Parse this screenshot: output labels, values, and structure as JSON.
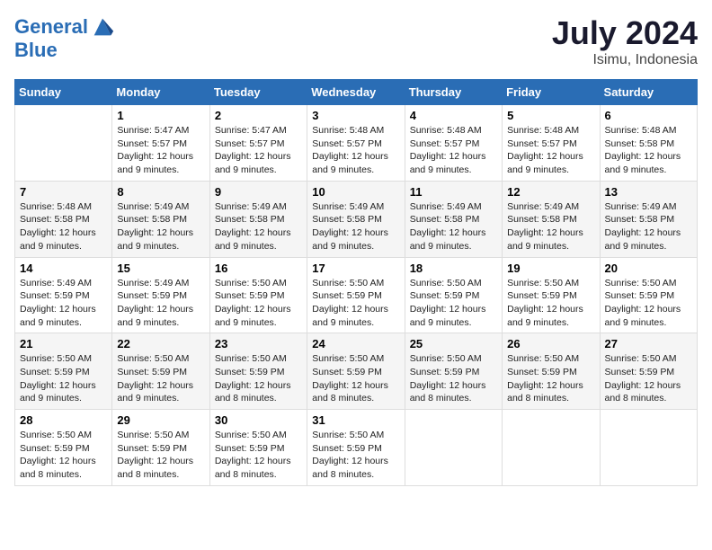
{
  "header": {
    "logo_line1": "General",
    "logo_line2": "Blue",
    "month_year": "July 2024",
    "location": "Isimu, Indonesia"
  },
  "days_of_week": [
    "Sunday",
    "Monday",
    "Tuesday",
    "Wednesday",
    "Thursday",
    "Friday",
    "Saturday"
  ],
  "weeks": [
    [
      {
        "day": "",
        "info": ""
      },
      {
        "day": "1",
        "info": "Sunrise: 5:47 AM\nSunset: 5:57 PM\nDaylight: 12 hours\nand 9 minutes."
      },
      {
        "day": "2",
        "info": "Sunrise: 5:47 AM\nSunset: 5:57 PM\nDaylight: 12 hours\nand 9 minutes."
      },
      {
        "day": "3",
        "info": "Sunrise: 5:48 AM\nSunset: 5:57 PM\nDaylight: 12 hours\nand 9 minutes."
      },
      {
        "day": "4",
        "info": "Sunrise: 5:48 AM\nSunset: 5:57 PM\nDaylight: 12 hours\nand 9 minutes."
      },
      {
        "day": "5",
        "info": "Sunrise: 5:48 AM\nSunset: 5:57 PM\nDaylight: 12 hours\nand 9 minutes."
      },
      {
        "day": "6",
        "info": "Sunrise: 5:48 AM\nSunset: 5:58 PM\nDaylight: 12 hours\nand 9 minutes."
      }
    ],
    [
      {
        "day": "7",
        "info": "Sunrise: 5:48 AM\nSunset: 5:58 PM\nDaylight: 12 hours\nand 9 minutes."
      },
      {
        "day": "8",
        "info": "Sunrise: 5:49 AM\nSunset: 5:58 PM\nDaylight: 12 hours\nand 9 minutes."
      },
      {
        "day": "9",
        "info": "Sunrise: 5:49 AM\nSunset: 5:58 PM\nDaylight: 12 hours\nand 9 minutes."
      },
      {
        "day": "10",
        "info": "Sunrise: 5:49 AM\nSunset: 5:58 PM\nDaylight: 12 hours\nand 9 minutes."
      },
      {
        "day": "11",
        "info": "Sunrise: 5:49 AM\nSunset: 5:58 PM\nDaylight: 12 hours\nand 9 minutes."
      },
      {
        "day": "12",
        "info": "Sunrise: 5:49 AM\nSunset: 5:58 PM\nDaylight: 12 hours\nand 9 minutes."
      },
      {
        "day": "13",
        "info": "Sunrise: 5:49 AM\nSunset: 5:58 PM\nDaylight: 12 hours\nand 9 minutes."
      }
    ],
    [
      {
        "day": "14",
        "info": "Sunrise: 5:49 AM\nSunset: 5:59 PM\nDaylight: 12 hours\nand 9 minutes."
      },
      {
        "day": "15",
        "info": "Sunrise: 5:49 AM\nSunset: 5:59 PM\nDaylight: 12 hours\nand 9 minutes."
      },
      {
        "day": "16",
        "info": "Sunrise: 5:50 AM\nSunset: 5:59 PM\nDaylight: 12 hours\nand 9 minutes."
      },
      {
        "day": "17",
        "info": "Sunrise: 5:50 AM\nSunset: 5:59 PM\nDaylight: 12 hours\nand 9 minutes."
      },
      {
        "day": "18",
        "info": "Sunrise: 5:50 AM\nSunset: 5:59 PM\nDaylight: 12 hours\nand 9 minutes."
      },
      {
        "day": "19",
        "info": "Sunrise: 5:50 AM\nSunset: 5:59 PM\nDaylight: 12 hours\nand 9 minutes."
      },
      {
        "day": "20",
        "info": "Sunrise: 5:50 AM\nSunset: 5:59 PM\nDaylight: 12 hours\nand 9 minutes."
      }
    ],
    [
      {
        "day": "21",
        "info": "Sunrise: 5:50 AM\nSunset: 5:59 PM\nDaylight: 12 hours\nand 9 minutes."
      },
      {
        "day": "22",
        "info": "Sunrise: 5:50 AM\nSunset: 5:59 PM\nDaylight: 12 hours\nand 9 minutes."
      },
      {
        "day": "23",
        "info": "Sunrise: 5:50 AM\nSunset: 5:59 PM\nDaylight: 12 hours\nand 8 minutes."
      },
      {
        "day": "24",
        "info": "Sunrise: 5:50 AM\nSunset: 5:59 PM\nDaylight: 12 hours\nand 8 minutes."
      },
      {
        "day": "25",
        "info": "Sunrise: 5:50 AM\nSunset: 5:59 PM\nDaylight: 12 hours\nand 8 minutes."
      },
      {
        "day": "26",
        "info": "Sunrise: 5:50 AM\nSunset: 5:59 PM\nDaylight: 12 hours\nand 8 minutes."
      },
      {
        "day": "27",
        "info": "Sunrise: 5:50 AM\nSunset: 5:59 PM\nDaylight: 12 hours\nand 8 minutes."
      }
    ],
    [
      {
        "day": "28",
        "info": "Sunrise: 5:50 AM\nSunset: 5:59 PM\nDaylight: 12 hours\nand 8 minutes."
      },
      {
        "day": "29",
        "info": "Sunrise: 5:50 AM\nSunset: 5:59 PM\nDaylight: 12 hours\nand 8 minutes."
      },
      {
        "day": "30",
        "info": "Sunrise: 5:50 AM\nSunset: 5:59 PM\nDaylight: 12 hours\nand 8 minutes."
      },
      {
        "day": "31",
        "info": "Sunrise: 5:50 AM\nSunset: 5:59 PM\nDaylight: 12 hours\nand 8 minutes."
      },
      {
        "day": "",
        "info": ""
      },
      {
        "day": "",
        "info": ""
      },
      {
        "day": "",
        "info": ""
      }
    ]
  ]
}
